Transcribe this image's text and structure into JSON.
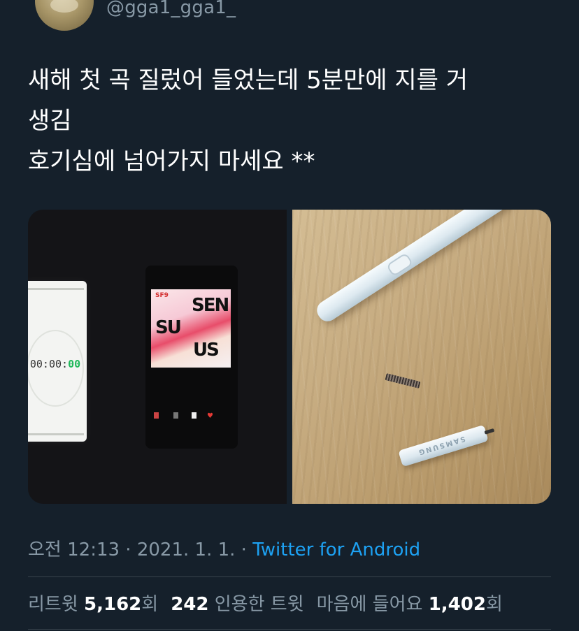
{
  "header": {
    "handle": "@gga1_gga1_"
  },
  "tweet": {
    "lines": [
      "새해 첫 곡 질렀어 들었는데 5분만에 지를 거",
      "생김",
      "호기심에 넘어가지 마세요 **"
    ]
  },
  "media": {
    "left_photo": {
      "stopwatch_time_prefix": "00:00:",
      "stopwatch_time_suffix": "00",
      "album_letters": [
        "SEN",
        "SU",
        "US"
      ],
      "album_artist_label": "SF9"
    },
    "right_photo": {
      "cap_text": "SAMSUNG"
    }
  },
  "meta": {
    "time": "오전 12:13",
    "sep1": " · ",
    "date": "2021. 1. 1.",
    "sep2": " · ",
    "source": "Twitter for Android"
  },
  "stats": {
    "retweets_label": "리트윗",
    "retweets_count": "5,162",
    "retweets_unit": "회",
    "quotes_count": "242",
    "quotes_label": "인용한 트윗",
    "likes_label": "마음에 들어요",
    "likes_count": "1,402",
    "likes_unit": "회"
  },
  "colors": {
    "background": "#15202b",
    "secondary_text": "#8899a6",
    "link": "#1da1f2",
    "divider": "#38444d"
  }
}
